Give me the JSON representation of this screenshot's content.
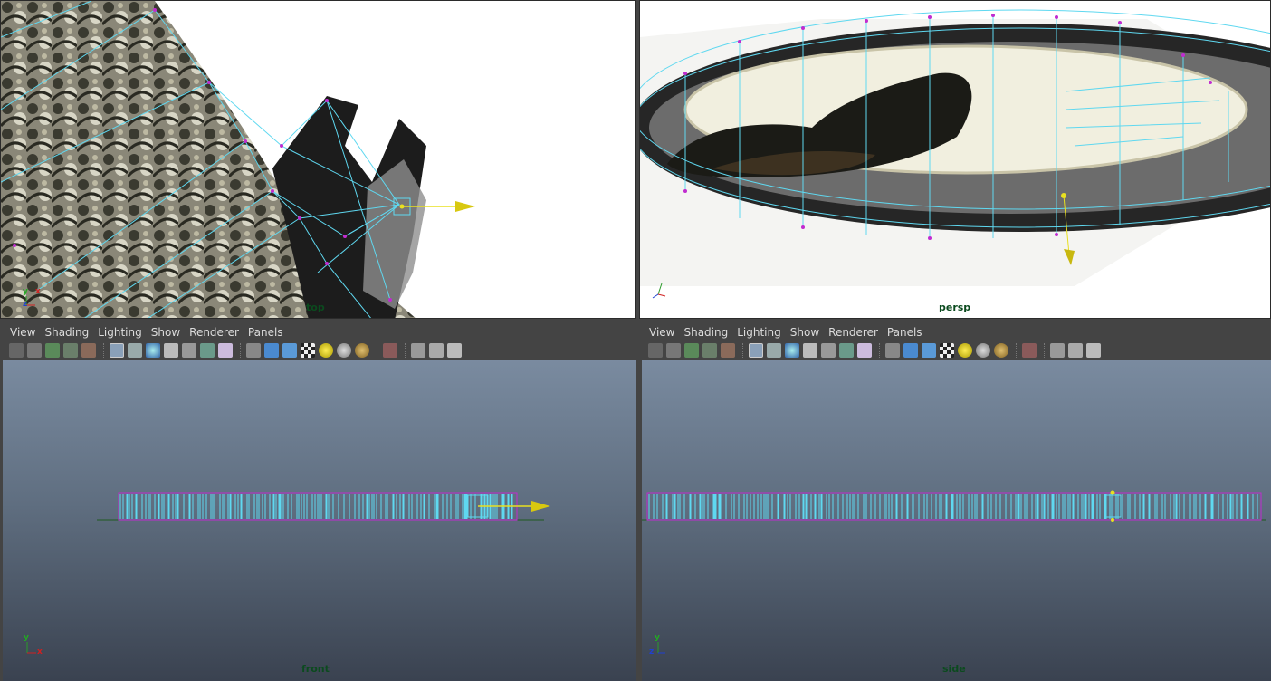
{
  "viewports": {
    "top": {
      "camera_label": "top"
    },
    "persp": {
      "camera_label": "persp"
    },
    "front": {
      "camera_label": "front"
    },
    "side": {
      "camera_label": "side"
    }
  },
  "panel_menu": [
    "View",
    "Shading",
    "Lighting",
    "Show",
    "Renderer",
    "Panels"
  ],
  "axis_letters": {
    "x": "x",
    "y": "y",
    "z": "z"
  },
  "colors": {
    "wireframe": "#5fd8f0",
    "vertex": "#c02cd0",
    "manipulator": "#e8e020",
    "panel_bg": "#444444",
    "menu_text": "#dcdcdc",
    "camera_label": "#0b4a1e"
  },
  "toolbar_icons": [
    "camera-select-icon",
    "camera-attributes-icon",
    "bookmark-icon",
    "image-plane-icon",
    "grease-pencil-icon",
    "wireframe-icon",
    "smooth-shade-icon",
    "default-material-icon",
    "flat-shade-icon",
    "xray-icon",
    "xray-joints-icon",
    "texture-icon",
    "resolution-gate-icon",
    "cube-shaded-icon",
    "cube-wire-icon",
    "checker-icon",
    "light-icon",
    "shadow-icon",
    "ao-icon",
    "isolate-select-icon",
    "grid-icon",
    "hud-icon",
    "share-icon"
  ]
}
